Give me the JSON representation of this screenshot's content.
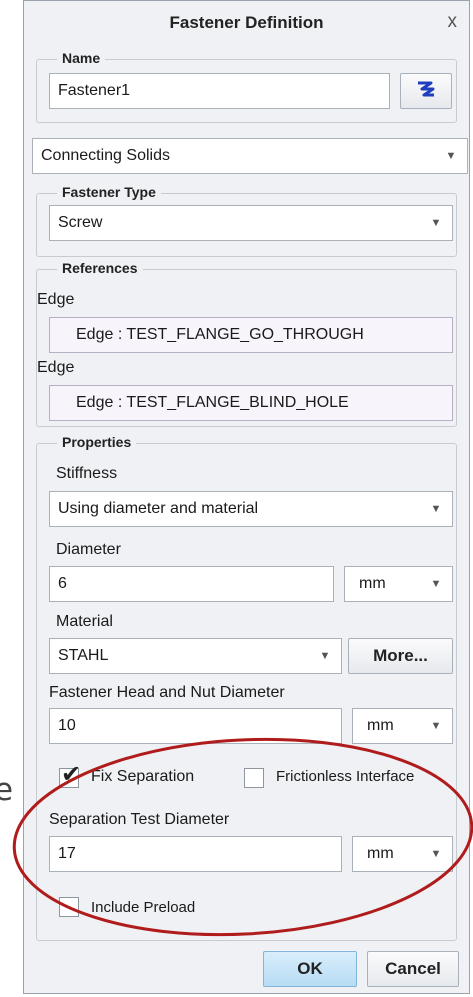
{
  "page_fragment": "e",
  "dialog": {
    "title": "Fastener Definition",
    "close": "x"
  },
  "name_group": {
    "legend": "Name",
    "value": "Fastener1",
    "icon": "z"
  },
  "connection": {
    "selected": "Connecting Solids"
  },
  "fastener_type": {
    "legend": "Fastener Type",
    "selected": "Screw"
  },
  "references": {
    "legend": "References",
    "items": [
      {
        "label": "Edge",
        "value": "Edge : TEST_FLANGE_GO_THROUGH"
      },
      {
        "label": "Edge",
        "value": "Edge : TEST_FLANGE_BLIND_HOLE"
      }
    ]
  },
  "properties": {
    "legend": "Properties",
    "stiffness": {
      "label": "Stiffness",
      "selected": "Using diameter and material"
    },
    "diameter": {
      "label": "Diameter",
      "value": "6",
      "unit": "mm"
    },
    "material": {
      "label": "Material",
      "selected": "STAHL",
      "more_label": "More..."
    },
    "head_nut_diameter": {
      "label": "Fastener Head and Nut Diameter",
      "value": "10",
      "unit": "mm"
    },
    "fix_separation": {
      "label": "Fix Separation",
      "checked": true
    },
    "frictionless_interface": {
      "label": "Frictionless Interface",
      "checked": false
    },
    "separation_test_diameter": {
      "label": "Separation Test Diameter",
      "value": "17",
      "unit": "mm"
    },
    "include_preload": {
      "label": "Include Preload",
      "checked": false
    }
  },
  "buttons": {
    "ok": "OK",
    "cancel": "Cancel"
  },
  "colors": {
    "dialog_bg": "#eff1f4",
    "highlight_ellipse": "#b01c1c",
    "name_icon": "#1f3fbf"
  }
}
